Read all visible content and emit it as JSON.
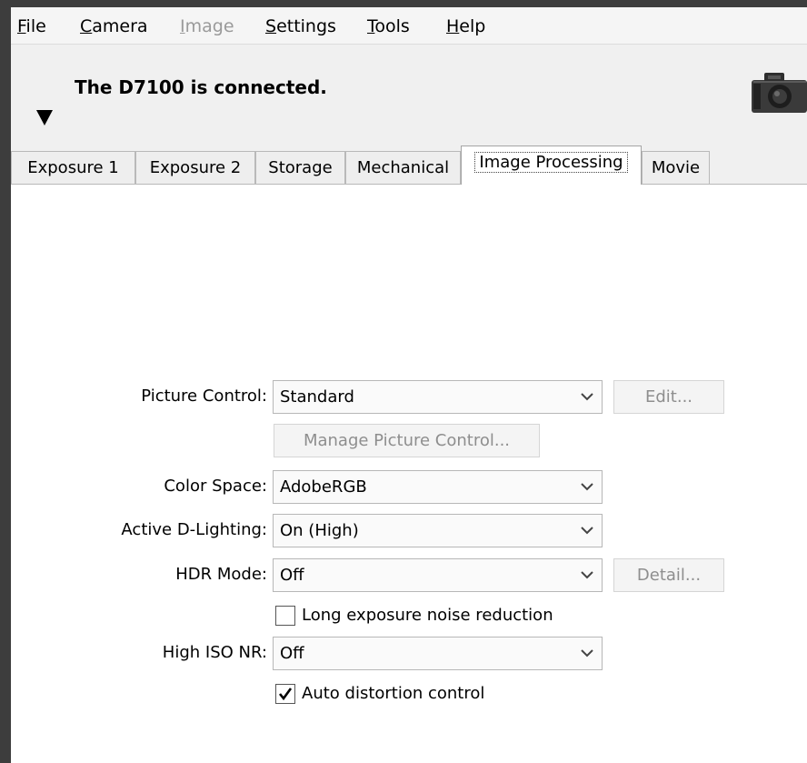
{
  "menubar": {
    "items": [
      {
        "pre": "",
        "key": "F",
        "post": "ile",
        "enabled": true
      },
      {
        "pre": "",
        "key": "C",
        "post": "amera",
        "enabled": true
      },
      {
        "pre": "",
        "key": "I",
        "post": "mage",
        "enabled": false
      },
      {
        "pre": "",
        "key": "S",
        "post": "ettings",
        "enabled": true
      },
      {
        "pre": "",
        "key": "T",
        "post": "ools",
        "enabled": true
      },
      {
        "pre": "",
        "key": "H",
        "post": "elp",
        "enabled": true
      }
    ]
  },
  "header": {
    "status": "The D7100 is connected."
  },
  "tabs": [
    {
      "label": "Exposure 1",
      "active": false
    },
    {
      "label": "Exposure 2",
      "active": false
    },
    {
      "label": "Storage",
      "active": false
    },
    {
      "label": "Mechanical",
      "active": false
    },
    {
      "label": "Image Processing",
      "active": true
    },
    {
      "label": "Movie",
      "active": false
    }
  ],
  "form": {
    "picture_control": {
      "label": "Picture Control:",
      "value": "Standard",
      "edit_button": "Edit..."
    },
    "manage_button": "Manage Picture Control...",
    "color_space": {
      "label": "Color Space:",
      "value": "AdobeRGB"
    },
    "active_d_lighting": {
      "label": "Active D-Lighting:",
      "value": "On (High)"
    },
    "hdr_mode": {
      "label": "HDR Mode:",
      "value": "Off",
      "detail_button": "Detail..."
    },
    "long_exposure_nr": {
      "label": "Long exposure noise reduction",
      "checked": false
    },
    "high_iso_nr": {
      "label": "High ISO NR:",
      "value": "Off"
    },
    "auto_distortion": {
      "label": "Auto distortion control",
      "checked": true
    }
  },
  "colors": {
    "outer_background": "#3d3d3d",
    "window_background": "#f0f0f0",
    "panel_background": "#ffffff",
    "disabled_text": "#8e8e8e"
  },
  "icons": [
    "dropdown-chevron-icon",
    "camera-icon",
    "checkmark-icon",
    "collapse-triangle-icon"
  ]
}
